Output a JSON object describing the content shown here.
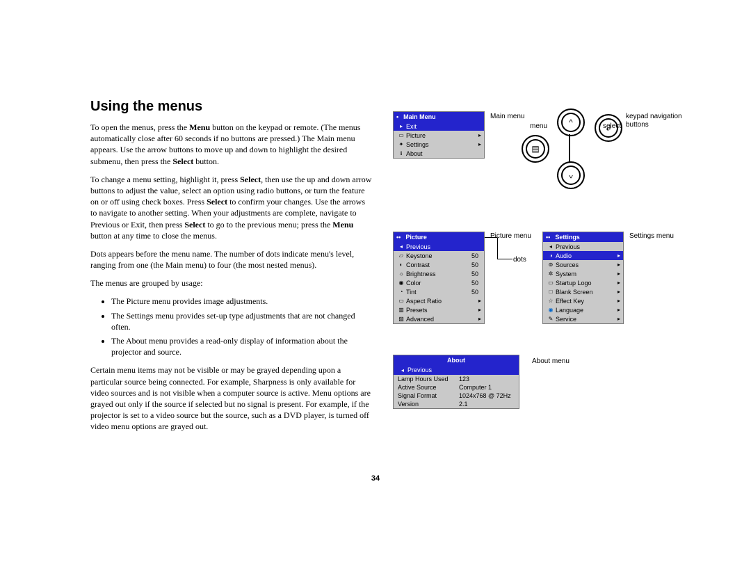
{
  "title": "Using the menus",
  "paragraphs": {
    "p1a": "To open the menus, press the ",
    "p1b": "Menu",
    "p1c": " button on the keypad or remote. (The menus automatically close after 60 seconds if no buttons are pressed.) The Main menu appears. Use the arrow buttons to move up and down to highlight the desired submenu, then press the ",
    "p1d": "Select",
    "p1e": " button.",
    "p2a": "To change a menu setting, highlight it, press ",
    "p2b": "Select",
    "p2c": ", then use the up and down arrow buttons to adjust the value, select an option using radio buttons, or turn the feature on or off using check boxes. Press ",
    "p2d": "Select",
    "p2e": " to confirm your changes. Use the arrows to navigate to another setting. When your adjustments are complete, navigate to Previous or Exit, then press ",
    "p2f": "Select",
    "p2g": " to go to the previous menu; press the ",
    "p2h": "Menu",
    "p2i": " button at any time to close the menus.",
    "p3": "Dots appears before the menu name. The number of dots indicate menu's level, ranging from one (the Main menu) to four (the most nested menus).",
    "p4": "The menus are grouped by usage:",
    "li1": "The Picture menu provides image adjustments.",
    "li2": "The Settings menu provides set-up type adjustments that are not changed often.",
    "li3": "The About menu provides a read-only display of information about the projector and source.",
    "p5": "Certain menu items may not be visible or may be grayed depending upon a particular source being connected. For example, Sharpness is only available for video sources and is not visible when a computer source is active. Menu options are grayed out only if the source if selected but no signal is present. For example, if the projector is set to a video source but the source, such as a DVD player, is turned off video menu options are grayed out."
  },
  "page_number": "34",
  "main_menu": {
    "header": "Main Menu",
    "items": [
      {
        "icon": "▸",
        "label": "Exit",
        "selected": true
      },
      {
        "icon": "▭",
        "label": "Picture",
        "arrow": "▸"
      },
      {
        "icon": "✦",
        "label": "Settings",
        "arrow": "▸"
      },
      {
        "icon": "i",
        "label": "About"
      }
    ]
  },
  "picture_menu": {
    "header": "Picture",
    "items": [
      {
        "icon": "◂",
        "label": "Previous",
        "selected": true
      },
      {
        "icon": "▱",
        "label": "Keystone",
        "val": "50"
      },
      {
        "icon": "◐",
        "label": "Contrast",
        "val": "50"
      },
      {
        "icon": "☼",
        "label": "Brightness",
        "val": "50"
      },
      {
        "icon": "◉",
        "label": "Color",
        "val": "50"
      },
      {
        "icon": "◔",
        "label": "Tint",
        "val": "50"
      },
      {
        "icon": "▭",
        "label": "Aspect Ratio",
        "arrow": "▸"
      },
      {
        "icon": "▥",
        "label": "Presets",
        "arrow": "▸"
      },
      {
        "icon": "▨",
        "label": "Advanced",
        "arrow": "▸"
      }
    ]
  },
  "settings_menu": {
    "header": "Settings",
    "items": [
      {
        "icon": "◂",
        "label": "Previous"
      },
      {
        "icon": "◑",
        "label": "Audio",
        "selected": true,
        "arrow": "▸"
      },
      {
        "icon": "⊚",
        "label": "Sources",
        "arrow": "▸"
      },
      {
        "icon": "✲",
        "label": "System",
        "arrow": "▸"
      },
      {
        "icon": "▭",
        "label": "Startup Logo",
        "arrow": "▸"
      },
      {
        "icon": "□",
        "label": "Blank Screen",
        "arrow": "▸"
      },
      {
        "icon": "☆",
        "label": "Effect Key",
        "arrow": "▸"
      },
      {
        "icon": "◉",
        "label": "Language",
        "arrow": "▸"
      },
      {
        "icon": "✎",
        "label": "Service",
        "arrow": "▸"
      }
    ]
  },
  "about_menu": {
    "header": "About",
    "prev": "Previous",
    "rows": [
      {
        "k": "Lamp Hours Used",
        "v": "123"
      },
      {
        "k": "Active Source",
        "v": "Computer 1"
      },
      {
        "k": "Signal Format",
        "v": "1024x768 @ 72Hz"
      },
      {
        "k": "Version",
        "v": "2.1"
      }
    ]
  },
  "captions": {
    "main_menu": "Main menu",
    "menu": "menu",
    "select": "select",
    "keypad": "keypad navigation buttons",
    "picture": "Picture menu",
    "settings": "Settings menu",
    "dots": "dots",
    "about": "About menu"
  }
}
